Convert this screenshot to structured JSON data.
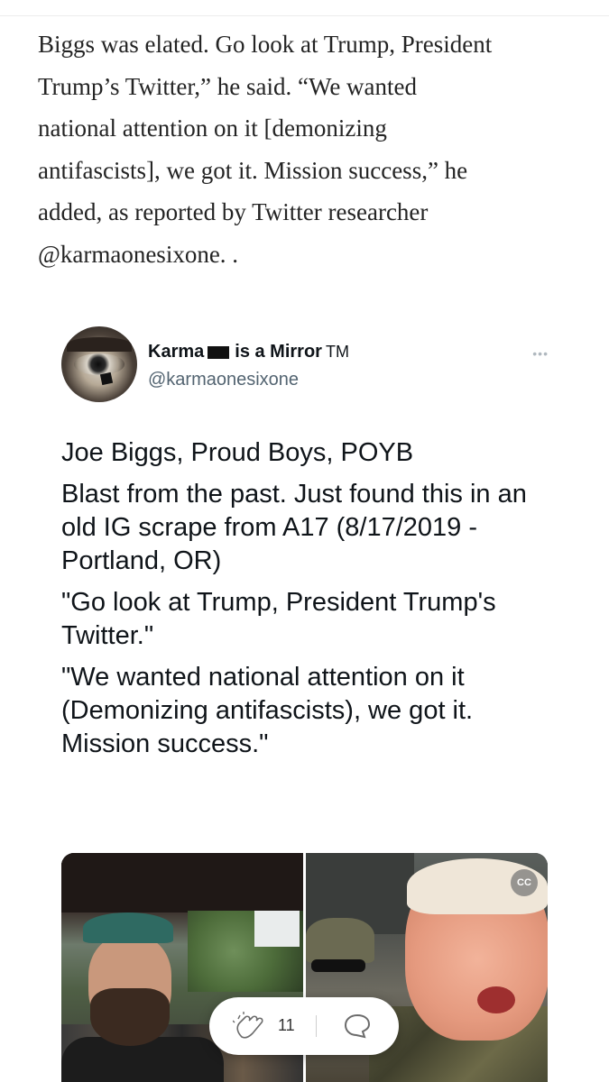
{
  "article": {
    "lines": [
      "Biggs was elated. Go look at Trump, President",
      "Trump’s Twitter,” he said. “We wanted",
      "national attention on it [demonizing",
      "antifascists], we got it. Mission success,” he",
      "added, as reported by Twitter researcher",
      "@karmaonesixone. ."
    ]
  },
  "tweet": {
    "name_part1": "Karma",
    "name_part2": "is a Mirror",
    "trademark": "TM",
    "handle": "@karmaonesixone",
    "more": "•••",
    "paragraphs": [
      "Joe Biggs, Proud Boys, POYB",
      "Blast from the past. Just found this in an old IG scrape from A17 (8/17/2019 - Portland, OR)",
      "\"Go look at Trump, President Trump's Twitter.\"",
      "\"We wanted national attention on it (Demonizing antifascists), we got it. Mission success.\""
    ],
    "cc_label": "CC"
  },
  "toolbar": {
    "clap_count": "11"
  },
  "colors": {
    "handle": "#536471",
    "article_text": "#242424"
  },
  "icons": [
    "avatar-image",
    "flag-icon",
    "more-icon",
    "cc-icon",
    "clap-icon",
    "comment-icon"
  ]
}
